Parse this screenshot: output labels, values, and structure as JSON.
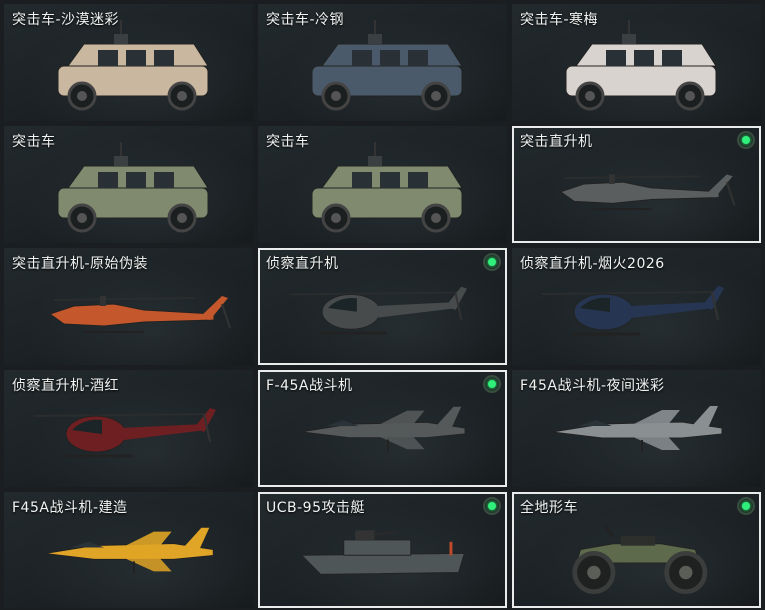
{
  "vehicles": [
    {
      "name": "突击车-沙漠迷彩",
      "icon": "armored-car-icon",
      "color": "#c9b79f",
      "selected": false,
      "equipped": false
    },
    {
      "name": "突击车-冷钢",
      "icon": "armored-car-icon",
      "color": "#4b5a6a",
      "selected": false,
      "equipped": false
    },
    {
      "name": "突击车-寒梅",
      "icon": "armored-car-icon",
      "color": "#d9d3cf",
      "selected": false,
      "equipped": false
    },
    {
      "name": "突击车",
      "icon": "armored-car-icon",
      "color": "#7f8a6e",
      "selected": false,
      "equipped": false
    },
    {
      "name": "突击车",
      "icon": "armored-car-icon",
      "color": "#7f8a6e",
      "selected": false,
      "equipped": false
    },
    {
      "name": "突击直升机",
      "icon": "attack-helicopter-icon",
      "color": "#5a5e5e",
      "selected": true,
      "equipped": true
    },
    {
      "name": "突击直升机-原始伪装",
      "icon": "attack-helicopter-icon",
      "color": "#c4572b",
      "selected": false,
      "equipped": false
    },
    {
      "name": "侦察直升机",
      "icon": "scout-helicopter-icon",
      "color": "#474b4c",
      "selected": true,
      "equipped": true
    },
    {
      "name": "侦察直升机-烟火2026",
      "icon": "scout-helicopter-icon",
      "color": "#263552",
      "selected": false,
      "equipped": false
    },
    {
      "name": "侦察直升机-酒红",
      "icon": "scout-helicopter-icon",
      "color": "#6e1f22",
      "selected": false,
      "equipped": false
    },
    {
      "name": "F-45A战斗机",
      "icon": "fighter-jet-icon",
      "color": "#55595a",
      "selected": true,
      "equipped": true
    },
    {
      "name": "F45A战斗机-夜间迷彩",
      "icon": "fighter-jet-icon",
      "color": "#8a8f92",
      "selected": false,
      "equipped": false
    },
    {
      "name": "F45A战斗机-建造",
      "icon": "fighter-jet-icon",
      "color": "#e0a526",
      "selected": false,
      "equipped": false
    },
    {
      "name": "UCB-95攻击艇",
      "icon": "attack-boat-icon",
      "color": "#4e5658",
      "selected": true,
      "equipped": true
    },
    {
      "name": "全地形车",
      "icon": "atv-icon",
      "color": "#5d6b4c",
      "selected": true,
      "equipped": true
    }
  ]
}
